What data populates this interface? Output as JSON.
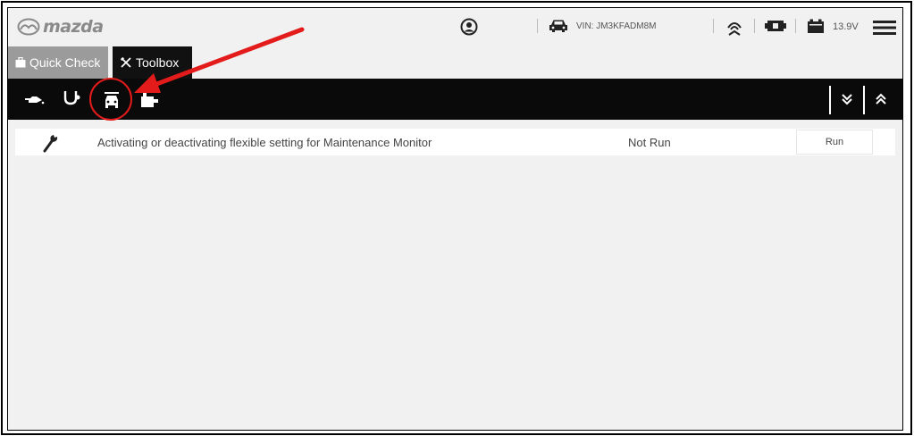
{
  "header": {
    "brand": "mazda",
    "vin_label": "VIN: JM3KFADM8M",
    "voltage": "13.9V"
  },
  "tabs": [
    {
      "label": "Quick Check",
      "active": false
    },
    {
      "label": "Toolbox",
      "active": true
    }
  ],
  "toolbar": {
    "icons": [
      "oil-can-icon",
      "stethoscope-icon",
      "vehicle-setting-icon",
      "puzzle-icon"
    ],
    "selected": "vehicle-setting-icon"
  },
  "procedures": [
    {
      "description": "Activating or deactivating flexible setting for Maintenance Monitor",
      "status": "Not Run",
      "action": "Run"
    }
  ],
  "colors": {
    "annotation": "#e31b1b",
    "toolbar_bg": "#0a0a0a",
    "tab_inactive": "#9b9b9b",
    "page_bg": "#f1f1f1"
  }
}
